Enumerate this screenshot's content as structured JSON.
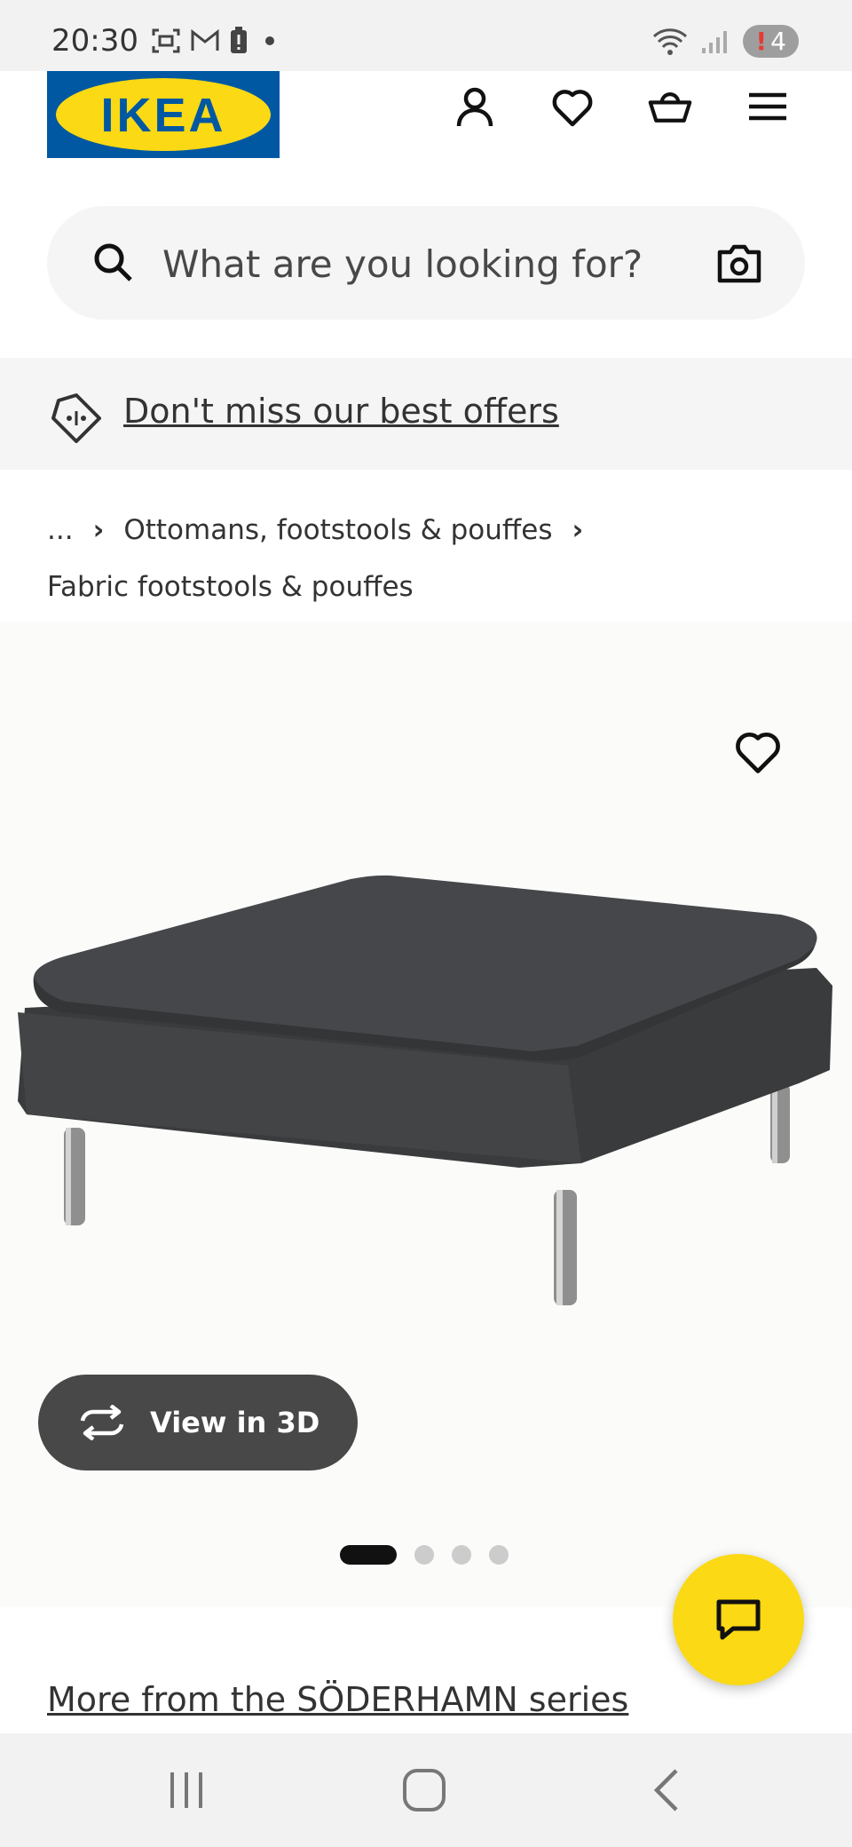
{
  "status_bar": {
    "time": "20:30",
    "notification_count": "4",
    "notification_alert": "!"
  },
  "header": {
    "logo_text": "IKEA"
  },
  "search": {
    "placeholder": "What are you looking for?"
  },
  "offers": {
    "link_text": "Don't miss our best offers"
  },
  "breadcrumb": {
    "ellipsis": "...",
    "items": [
      "Ottomans, footstools & pouffes",
      "Fabric footstools & pouffes"
    ]
  },
  "product": {
    "view3d_label": "View in 3D",
    "image_count": 4,
    "active_image": 1
  },
  "series": {
    "link_text": "More from the SÖDERHAMN series"
  },
  "colors": {
    "ikea_blue": "#0058a3",
    "ikea_yellow": "#fbd914",
    "button_dark": "#484848"
  }
}
